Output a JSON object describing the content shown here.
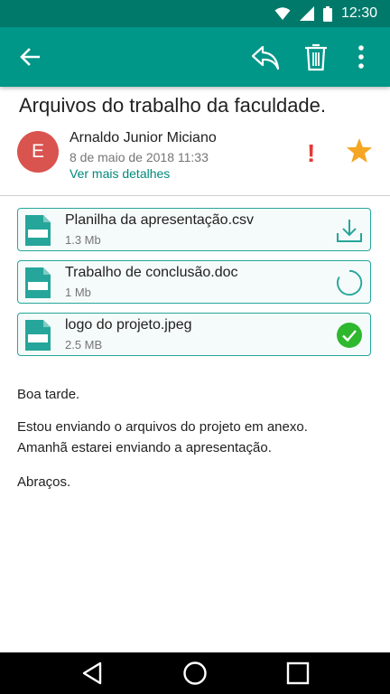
{
  "status_bar": {
    "time": "12:30"
  },
  "app_bar": {
    "back_icon": "arrow-left-icon",
    "reply_icon": "reply-icon",
    "delete_icon": "trash-icon",
    "more_icon": "more-vert-icon"
  },
  "email": {
    "subject": "Arquivos do trabalho da faculdade.",
    "avatar_letter": "E",
    "sender_name": "Arnaldo Junior Miciano",
    "date": "8 de maio de 2018 11:33",
    "details_link": "Ver mais detalhes",
    "important_mark": "!"
  },
  "attachments": [
    {
      "name": "Planilha da apresentação.csv",
      "size": "1.3 Mb",
      "state": "download"
    },
    {
      "name": "Trabalho de conclusão.doc",
      "size": "1 Mb",
      "state": "loading"
    },
    {
      "name": "logo do projeto.jpeg",
      "size": "2.5 MB",
      "state": "done"
    }
  ],
  "body": {
    "greeting": "Boa tarde.",
    "line1": "Estou enviando o arquivos  do projeto em anexo.",
    "line2": "Amanhã estarei enviando a apresentação.",
    "closing": "Abraços."
  },
  "colors": {
    "primary": "#009688",
    "primary_dark": "#00796B",
    "star": "#F5A623",
    "important": "#E53935",
    "avatar": "#D9534F",
    "done": "#2EB82E"
  }
}
